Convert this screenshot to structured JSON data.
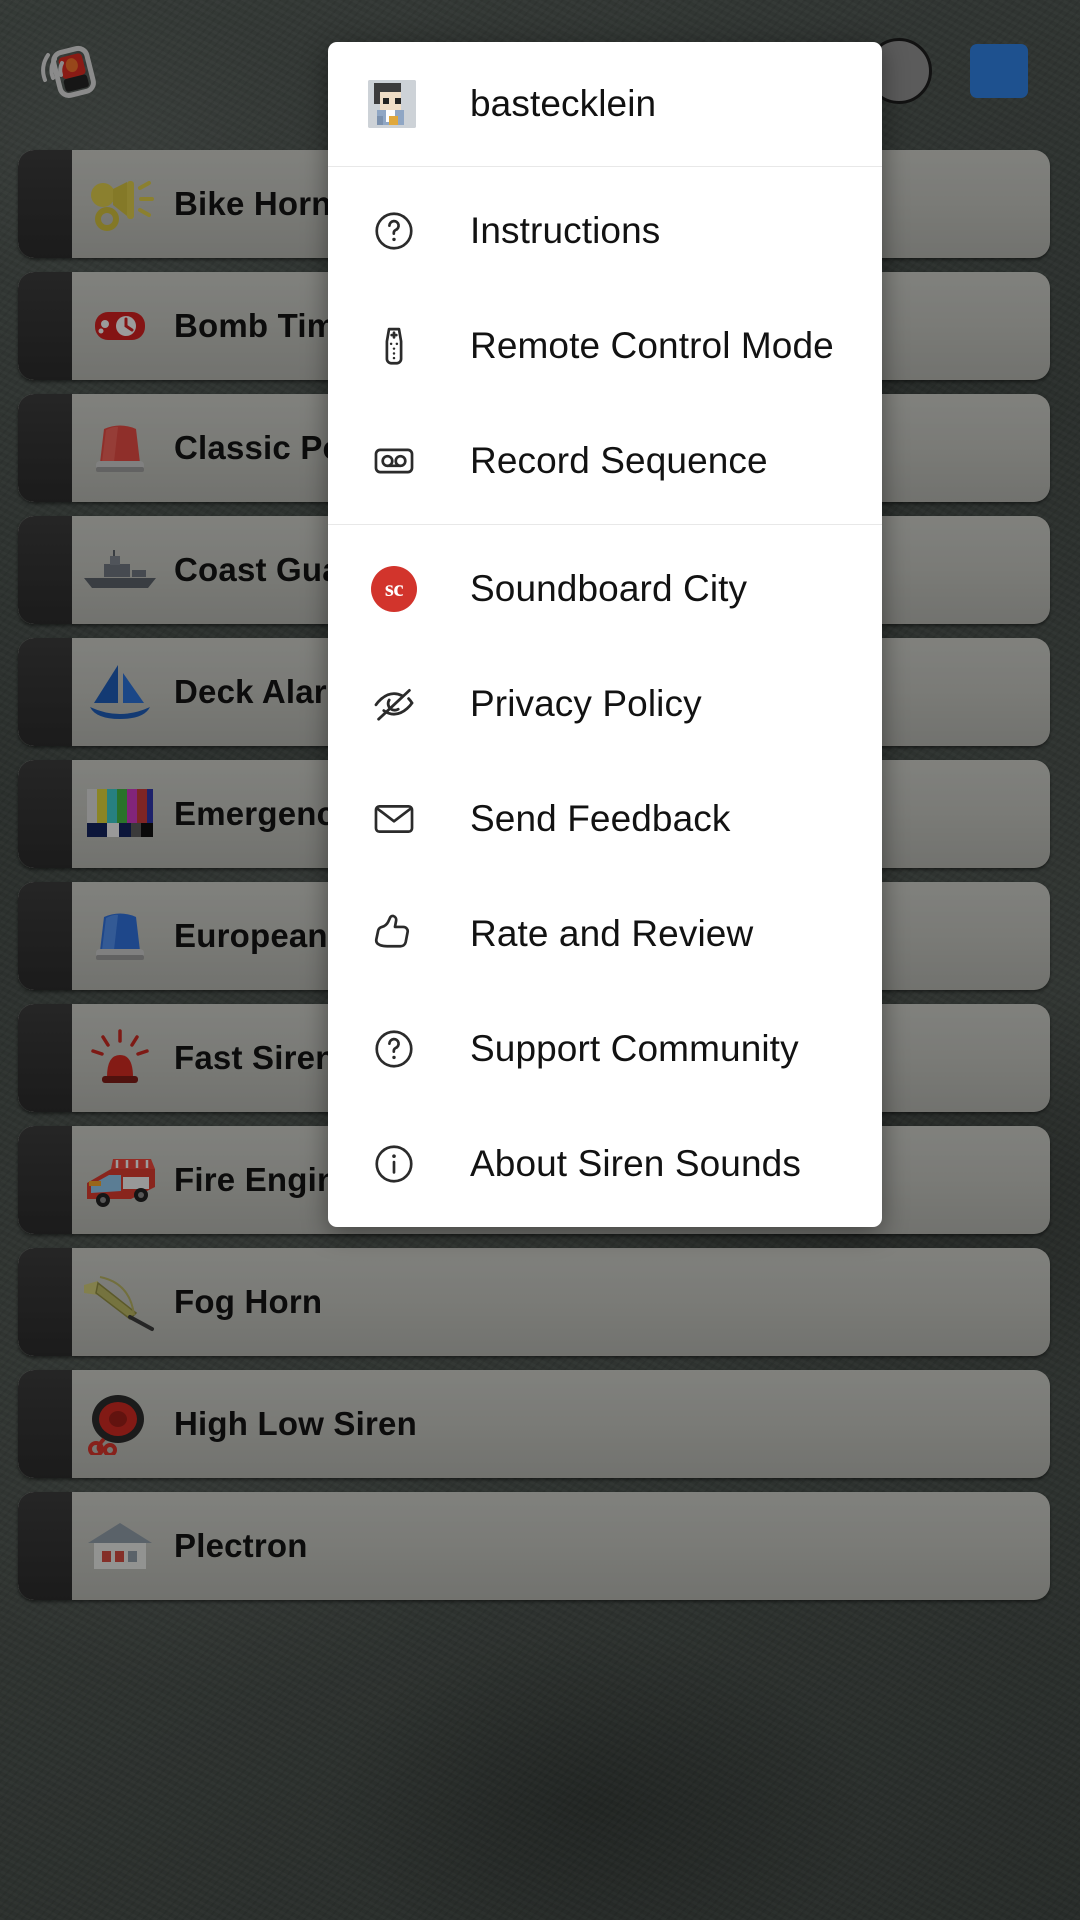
{
  "app": {
    "logo_icon": "siren-beacon-icon",
    "avatar_icon": "user-avatar",
    "action_icon": "blue-action-button"
  },
  "sound_list": {
    "items": [
      {
        "label": "Bike Horn",
        "icon": "bike-horn-icon",
        "glyph": "📢"
      },
      {
        "label": "Bomb Timer",
        "icon": "bomb-timer-icon",
        "glyph": "⏱"
      },
      {
        "label": "Classic Police",
        "icon": "classic-police-icon",
        "glyph": "🚨"
      },
      {
        "label": "Coast Guard",
        "icon": "coast-guard-icon",
        "glyph": "🚢"
      },
      {
        "label": "Deck Alarm",
        "icon": "deck-alarm-icon",
        "glyph": "⛵"
      },
      {
        "label": "Emergency",
        "icon": "emergency-icon",
        "glyph": "📺"
      },
      {
        "label": "European Siren",
        "icon": "european-siren-icon",
        "glyph": "🔵"
      },
      {
        "label": "Fast Siren",
        "icon": "fast-siren-icon",
        "glyph": "🚨"
      },
      {
        "label": "Fire Engine",
        "icon": "fire-engine-icon",
        "glyph": "🚒"
      },
      {
        "label": "Fog Horn",
        "icon": "fog-horn-icon",
        "glyph": "🎺"
      },
      {
        "label": "High Low Siren",
        "icon": "high-low-siren-icon",
        "glyph": "📢"
      },
      {
        "label": "Plectron",
        "icon": "plectron-icon",
        "glyph": "🏠"
      }
    ]
  },
  "menu": {
    "account": {
      "name": "bastecklein",
      "avatar_icon": "account-avatar"
    },
    "group_primary": [
      {
        "label": "Instructions",
        "icon": "question-circle-icon"
      },
      {
        "label": "Remote Control Mode",
        "icon": "remote-control-icon"
      },
      {
        "label": "Record Sequence",
        "icon": "cassette-tape-icon"
      }
    ],
    "group_secondary": [
      {
        "label": "Soundboard City",
        "icon": "soundboard-city-logo-icon",
        "badge_text": "sc",
        "badge_color": "#d2342c"
      },
      {
        "label": "Privacy Policy",
        "icon": "eye-off-icon"
      },
      {
        "label": "Send Feedback",
        "icon": "envelope-icon"
      },
      {
        "label": "Rate and Review",
        "icon": "thumbs-up-icon"
      },
      {
        "label": "Support Community",
        "icon": "question-circle-icon"
      },
      {
        "label": "About Siren Sounds",
        "icon": "info-circle-icon"
      }
    ]
  },
  "colors": {
    "menu_background": "#ffffff",
    "menu_text": "#121212",
    "row_background": "#c0c1bb",
    "row_tab": "#333333",
    "accent_red": "#d2342c",
    "accent_blue": "#2f7fe0"
  }
}
